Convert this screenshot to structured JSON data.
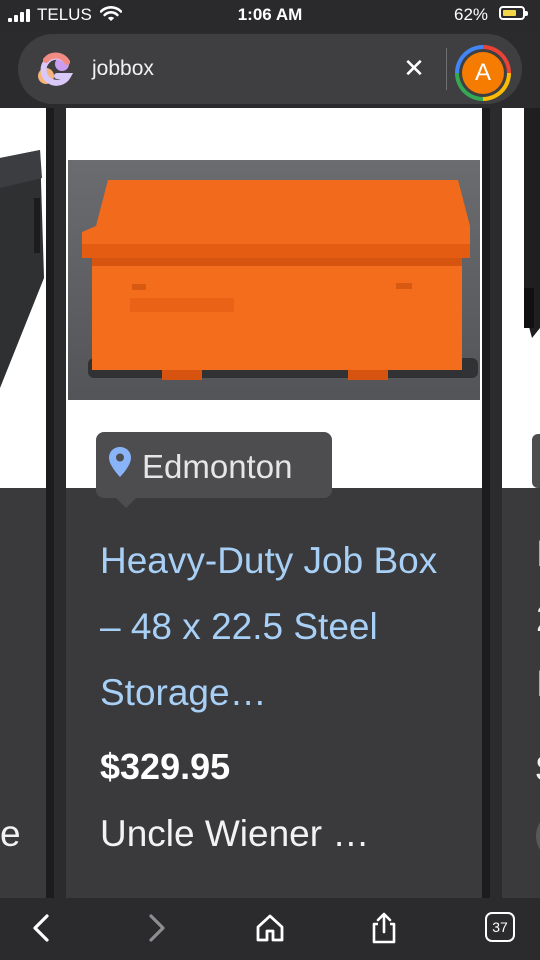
{
  "status_bar": {
    "carrier": "TELUS",
    "time": "1:06 AM",
    "battery_percent": "62%",
    "battery_level": 0.62
  },
  "search": {
    "query": "jobbox",
    "avatar_letter": "A"
  },
  "listing": {
    "location": "Edmonton",
    "title": "Heavy-Duty Job Box – 48 x 22.5 Steel Storage…",
    "price": "$329.95",
    "seller": "Uncle Wiener …"
  },
  "toolbar": {
    "tab_count": "37"
  },
  "icons": [
    "google-logo-icon",
    "clear-icon",
    "location-pin-icon",
    "back-icon",
    "forward-icon",
    "home-icon",
    "share-icon",
    "tabs-icon"
  ],
  "colors": {
    "background": "#2b2b2d",
    "link_blue": "#a8d0f6",
    "box_orange": "#f26a1b",
    "avatar_orange": "#f57c00"
  }
}
